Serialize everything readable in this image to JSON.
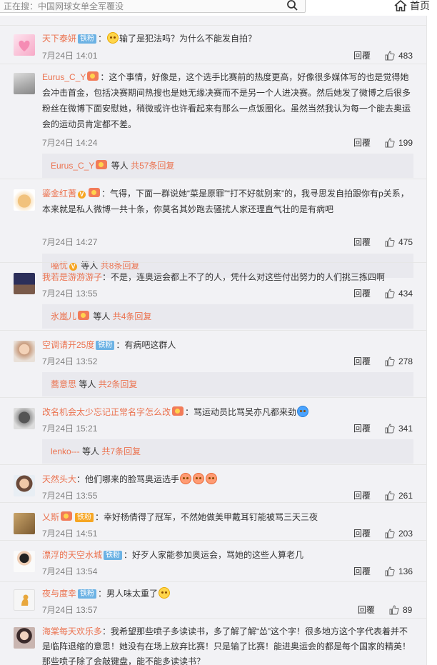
{
  "header": {
    "search_placeholder": "正在搜：中国网球女单全军覆没",
    "home_label": "首页"
  },
  "comments": [
    {
      "user": "天下泰妍",
      "badge": "铁粉",
      "text": "输了是犯法吗？为什么不能发自拍？",
      "time": "7月24日 14:01",
      "reply": "回覆",
      "likes": "483"
    },
    {
      "user": "Eurus_C_Y",
      "text": "这个事情，好像是，这个选手比赛前的热度更高，好像很多媒体写的也是觉得她会冲击首金，包括决赛期间热搜也是她无缘决赛而不是另一个人进决赛。然后她发了微博之后很多粉丝在微博下面安慰她，稍微或许也许看起来有那么一点饭圈化。虽然当然我认为每一个能去奥运会的运动员肯定都不差。",
      "time": "7月24日 14:24",
      "reply": "回覆",
      "likes": "199",
      "sub": {
        "user": "Eurus_C_Y",
        "mid": "等人",
        "more": "共57条回复"
      }
    },
    {
      "user": "鎏金红蓍",
      "text": "气得，下面一群说她“菜是原罪”“打不好就别来”的，我寻思发自拍跟你有p关系，本来就是私人微博一共十条，你莫名其妙跑去骚扰人家还理直气壮的是有病吧",
      "time": "7月24日 14:27",
      "reply": "回覆",
      "likes": "475",
      "sub": {
        "user": "嗑忧",
        "mid": "等人",
        "more": "共8条回复"
      }
    },
    {
      "user": "我若是游游游子",
      "text": "不是，连奥运会都上不了的人，凭什么对这些付出努力的人们挑三拣四啊",
      "time": "7月24日 13:55",
      "reply": "回覆",
      "likes": "434",
      "sub": {
        "user": "氷嵐儿",
        "mid": "等人",
        "more": "共4条回复"
      }
    },
    {
      "user": "空调请开25度",
      "badge": "铁粉",
      "text": "有病吧这群人",
      "time": "7月24日 13:52",
      "reply": "回覆",
      "likes": "278",
      "sub": {
        "user": "蕎意思",
        "mid": "等人",
        "more": "共2条回复"
      }
    },
    {
      "user": "改名机会太少忘记正常名字怎么改",
      "text": "骂运动员比骂吴亦凡都来劲",
      "time": "7月24日 15:21",
      "reply": "回覆",
      "likes": "341",
      "sub": {
        "user": "lenko---",
        "mid": "等人",
        "more": "共7条回复"
      }
    },
    {
      "user": "天然头大",
      "text": "他们哪来的脸骂奥运选手",
      "time": "7月24日 13:55",
      "reply": "回覆",
      "likes": "261"
    },
    {
      "user": "乂斯",
      "badge": "铁粉",
      "text": "幸好杨倩得了冠军，不然她做美甲戴耳钉能被骂三天三夜",
      "time": "7月24日 14:51",
      "reply": "回覆",
      "likes": "203"
    },
    {
      "user": "漂浮的天空水城",
      "badge": "铁粉",
      "text": "好歹人家能参加奥运会，骂她的这些人算老几",
      "time": "7月24日 13:54",
      "reply": "回覆",
      "likes": "136"
    },
    {
      "user": "夜与度幸",
      "badge": "铁粉",
      "text": "男人味太重了",
      "time": "7月24日 13:57",
      "reply": "回覆",
      "likes": "89"
    },
    {
      "user": "海棠每天欢乐多",
      "text": "我希望那些喷子多读读书，多了解了解“怂”这个字！很多地方这个字代表着并不是临阵退缩的意思！她没有在场上放弃比赛！只是输了比赛！能进奥运会的都是每个国家的精英！那些喷子除了会敲键盘，能不能多读读书？"
    }
  ],
  "colors": {
    "username": "#eb7350",
    "badge": "#6cb2e4",
    "background": "#f2f2f5",
    "subreply_bg": "#e9e9ee"
  }
}
